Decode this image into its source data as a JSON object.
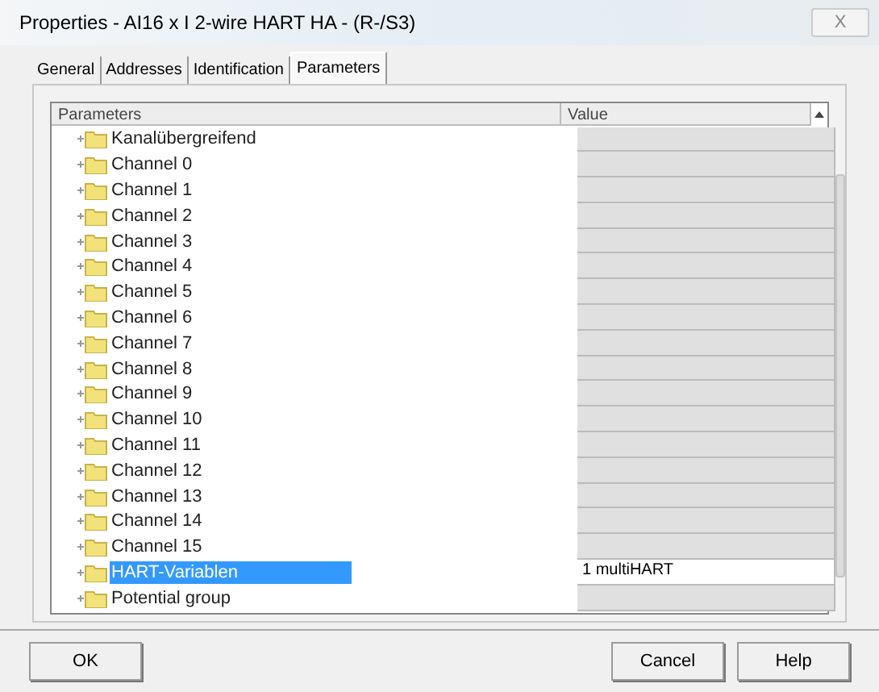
{
  "window": {
    "title": "Properties - AI16 x I 2-wire HART HA - (R-/S3)",
    "close": "X"
  },
  "tabs": [
    {
      "label": "General",
      "selected": false
    },
    {
      "label": "Addresses",
      "selected": false
    },
    {
      "label": "Identification",
      "selected": false
    },
    {
      "label": "Parameters",
      "selected": true
    }
  ],
  "table": {
    "columns": [
      "Parameters",
      "Value"
    ],
    "rows": [
      {
        "name": "Kanalübergreifend",
        "selected": false
      },
      {
        "name": "Channel 0",
        "selected": false
      },
      {
        "name": "Channel 1",
        "selected": false
      },
      {
        "name": "Channel 2",
        "selected": false
      },
      {
        "name": "Channel 3",
        "selected": false
      },
      {
        "name": "Channel 4",
        "selected": false
      },
      {
        "name": "Channel 5",
        "selected": false
      },
      {
        "name": "Channel 6",
        "selected": false
      },
      {
        "name": "Channel 7",
        "selected": false
      },
      {
        "name": "Channel 8",
        "selected": false
      },
      {
        "name": "Channel 9",
        "selected": false
      },
      {
        "name": "Channel 10",
        "selected": false
      },
      {
        "name": "Channel 11",
        "selected": false
      },
      {
        "name": "Channel 12",
        "selected": false
      },
      {
        "name": "Channel 13",
        "selected": false
      },
      {
        "name": "Channel 14",
        "selected": false
      },
      {
        "name": "Channel 15",
        "selected": false
      },
      {
        "name": "HART-Variablen",
        "selected": true,
        "value": "1 multiHART"
      },
      {
        "name": "Potential group",
        "selected": false
      }
    ]
  },
  "buttons": [
    {
      "label": "OK",
      "kind": "left"
    },
    {
      "label": "Cancel",
      "kind": "right"
    },
    {
      "label": "Help",
      "kind": "right"
    }
  ]
}
